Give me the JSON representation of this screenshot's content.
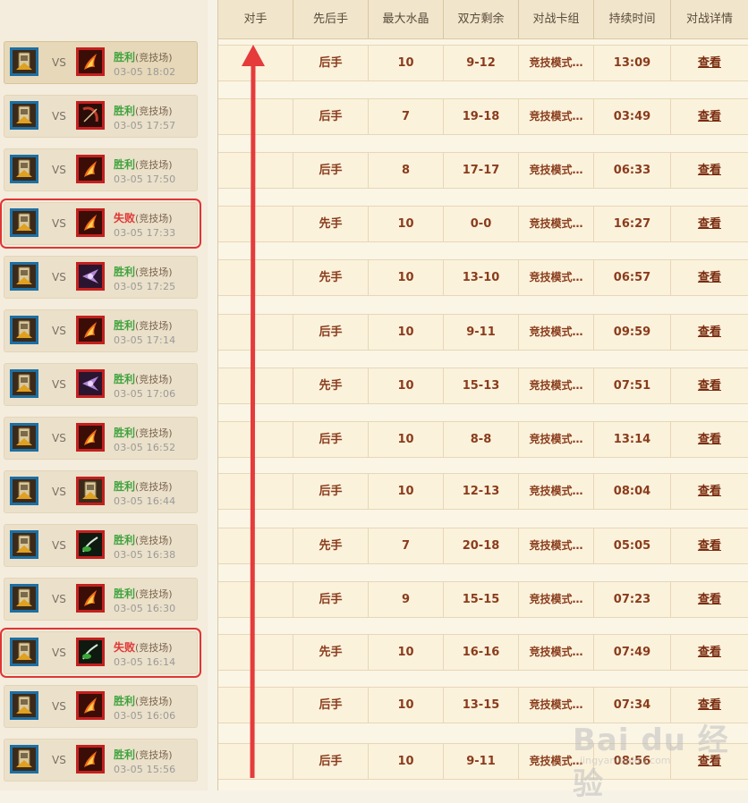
{
  "headers": [
    "对手",
    "先后手",
    "最大水晶",
    "双方剩余",
    "对战卡组",
    "持续时间",
    "对战详情"
  ],
  "matches": [
    {
      "own_icon": "card-icon",
      "opp_icon": "flame-icon",
      "result": "胜利",
      "mode": "(竞技场)",
      "time": "03-05 18:02",
      "order": "后手",
      "crystal": "10",
      "remaining": "9-12",
      "deck": "竞技模式…",
      "duration": "13:09",
      "detail": "查看"
    },
    {
      "own_icon": "card-icon",
      "opp_icon": "bow-icon",
      "result": "胜利",
      "mode": "(竞技场)",
      "time": "03-05 17:57",
      "order": "后手",
      "crystal": "7",
      "remaining": "19-18",
      "deck": "竞技模式…",
      "duration": "03:49",
      "detail": "查看"
    },
    {
      "own_icon": "card-icon",
      "opp_icon": "flame-icon",
      "result": "胜利",
      "mode": "(竞技场)",
      "time": "03-05 17:50",
      "order": "后手",
      "crystal": "8",
      "remaining": "17-17",
      "deck": "竞技模式…",
      "duration": "06:33",
      "detail": "查看"
    },
    {
      "own_icon": "card-icon",
      "opp_icon": "flame-icon",
      "result": "失败",
      "mode": "(竞技场)",
      "time": "03-05 17:33",
      "order": "先手",
      "crystal": "10",
      "remaining": "0-0",
      "deck": "竞技模式…",
      "duration": "16:27",
      "detail": "查看"
    },
    {
      "own_icon": "card-icon",
      "opp_icon": "shadow-icon",
      "result": "胜利",
      "mode": "(竞技场)",
      "time": "03-05 17:25",
      "order": "先手",
      "crystal": "10",
      "remaining": "13-10",
      "deck": "竞技模式…",
      "duration": "06:57",
      "detail": "查看"
    },
    {
      "own_icon": "card-icon",
      "opp_icon": "flame-icon",
      "result": "胜利",
      "mode": "(竞技场)",
      "time": "03-05 17:14",
      "order": "后手",
      "crystal": "10",
      "remaining": "9-11",
      "deck": "竞技模式…",
      "duration": "09:59",
      "detail": "查看"
    },
    {
      "own_icon": "card-icon",
      "opp_icon": "shadow-icon",
      "result": "胜利",
      "mode": "(竞技场)",
      "time": "03-05 17:06",
      "order": "先手",
      "crystal": "10",
      "remaining": "15-13",
      "deck": "竞技模式…",
      "duration": "07:51",
      "detail": "查看"
    },
    {
      "own_icon": "card-icon",
      "opp_icon": "flame-icon",
      "result": "胜利",
      "mode": "(竞技场)",
      "time": "03-05 16:52",
      "order": "后手",
      "crystal": "10",
      "remaining": "8-8",
      "deck": "竞技模式…",
      "duration": "13:14",
      "detail": "查看"
    },
    {
      "own_icon": "card-icon",
      "opp_icon": "card-icon",
      "result": "胜利",
      "mode": "(竞技场)",
      "time": "03-05 16:44",
      "order": "后手",
      "crystal": "10",
      "remaining": "12-13",
      "deck": "竞技模式…",
      "duration": "08:04",
      "detail": "查看"
    },
    {
      "own_icon": "card-icon",
      "opp_icon": "nature-icon",
      "result": "胜利",
      "mode": "(竞技场)",
      "time": "03-05 16:38",
      "order": "先手",
      "crystal": "7",
      "remaining": "20-18",
      "deck": "竞技模式…",
      "duration": "05:05",
      "detail": "查看"
    },
    {
      "own_icon": "card-icon",
      "opp_icon": "flame-icon",
      "result": "胜利",
      "mode": "(竞技场)",
      "time": "03-05 16:30",
      "order": "后手",
      "crystal": "9",
      "remaining": "15-15",
      "deck": "竞技模式…",
      "duration": "07:23",
      "detail": "查看"
    },
    {
      "own_icon": "card-icon",
      "opp_icon": "nature-icon",
      "result": "失败",
      "mode": "(竞技场)",
      "time": "03-05 16:14",
      "order": "先手",
      "crystal": "10",
      "remaining": "16-16",
      "deck": "竞技模式…",
      "duration": "07:49",
      "detail": "查看"
    },
    {
      "own_icon": "card-icon",
      "opp_icon": "flame-icon",
      "result": "胜利",
      "mode": "(竞技场)",
      "time": "03-05 16:06",
      "order": "后手",
      "crystal": "10",
      "remaining": "13-15",
      "deck": "竞技模式…",
      "duration": "07:34",
      "detail": "查看"
    },
    {
      "own_icon": "card-icon",
      "opp_icon": "flame-icon",
      "result": "胜利",
      "mode": "(竞技场)",
      "time": "03-05 15:56",
      "order": "后手",
      "crystal": "10",
      "remaining": "9-11",
      "deck": "竞技模式…",
      "duration": "08:56",
      "detail": "查看"
    }
  ],
  "vs_label": "VS",
  "colors": {
    "win": "#3fa33f",
    "loss": "#e03535",
    "cell_text": "#8a3c1c",
    "own_frame": "#1d6fa3",
    "opp_frame": "#c41f1f",
    "arrow": "#e53b3b"
  },
  "watermark": {
    "brand": "Bai du 经验",
    "url": "jingyan.baidu.com"
  }
}
